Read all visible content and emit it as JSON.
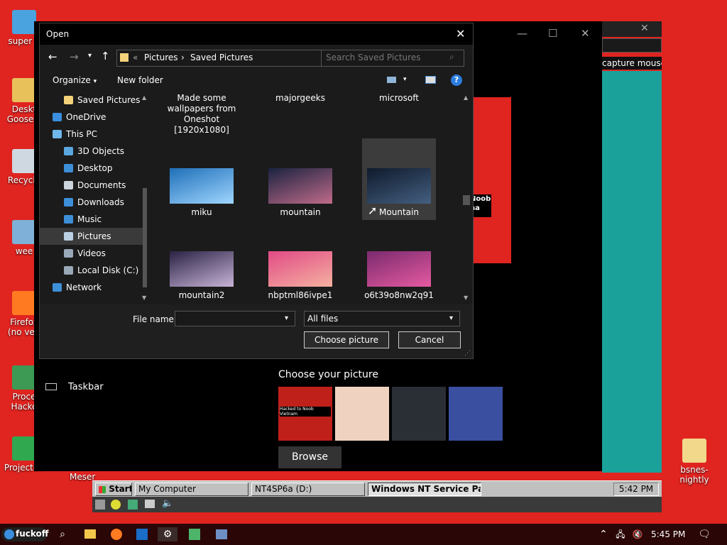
{
  "desktop": {
    "icons_left": [
      {
        "label": "super p",
        "color": "#4aa3df"
      },
      {
        "label": "Deskt\nGoose v",
        "color": "#e8c15b"
      },
      {
        "label": "Recycle",
        "color": "#cfd8e0"
      },
      {
        "label": "wee",
        "color": "#7fb0d8"
      },
      {
        "label": "Firefox\n(no veri",
        "color": "#ff7a20"
      },
      {
        "label": "Proce\nHacke",
        "color": "#3c9a54"
      },
      {
        "label": "Project64",
        "color": "#2fa84f"
      }
    ],
    "meser_label": "Meser",
    "right_icon": {
      "label": "bsnes-nightly",
      "color": "#f1d88a"
    }
  },
  "settings_bg": {
    "taskbar_label": "Taskbar",
    "choose_picture_heading": "Choose your picture",
    "browse_label": "Browse",
    "capture_mouse": "capture mouse",
    "thumbs": [
      {
        "name": "hacked-image",
        "color": "#c0201a",
        "text": "Hacked to Noob Vietnam"
      },
      {
        "name": "claymation-figure",
        "color": "#f0d2c0"
      },
      {
        "name": "text-screenshot",
        "color": "#2a2f36"
      },
      {
        "name": "collage",
        "color": "#3a4fa0"
      },
      {
        "name": "white-character",
        "color": "#000000"
      }
    ],
    "noob_label": "Noob\nha"
  },
  "dialog": {
    "title": "Open",
    "breadcrumb": {
      "prefix": "«",
      "part1": "Pictures",
      "sep": "›",
      "part2": "Saved Pictures"
    },
    "search_placeholder": "Search Saved Pictures",
    "toolbar": {
      "organize": "Organize",
      "new_folder": "New folder"
    },
    "nav": [
      {
        "label": "Saved Pictures",
        "icon": "folder-icon",
        "color": "#f3d27a"
      },
      {
        "label": "OneDrive",
        "icon": "cloud-icon",
        "color": "#3a8fde"
      },
      {
        "label": "This PC",
        "icon": "computer-icon",
        "color": "#6fb8ec"
      },
      {
        "label": "3D Objects",
        "icon": "cube-icon",
        "color": "#5aa7e0"
      },
      {
        "label": "Desktop",
        "icon": "desktop-icon",
        "color": "#3d8fd8"
      },
      {
        "label": "Documents",
        "icon": "document-icon",
        "color": "#ccd4dc"
      },
      {
        "label": "Downloads",
        "icon": "download-icon",
        "color": "#3d8fd8"
      },
      {
        "label": "Music",
        "icon": "music-icon",
        "color": "#3d8fd8"
      },
      {
        "label": "Pictures",
        "icon": "pictures-icon",
        "color": "#bcd0e4"
      },
      {
        "label": "Videos",
        "icon": "video-icon",
        "color": "#9aa9b8"
      },
      {
        "label": "Local Disk (C:)",
        "icon": "disk-icon",
        "color": "#9aa9b8"
      },
      {
        "label": "Network",
        "icon": "network-icon",
        "color": "#3d8fd8"
      }
    ],
    "top_row": [
      "Made some wallpapers from Oneshot [1920x1080]",
      "majorgeeks",
      "microsoft"
    ],
    "files": [
      {
        "label": "miku",
        "c1": "#1f6fb8",
        "c2": "#9fd6ff"
      },
      {
        "label": "mountain",
        "c1": "#1a2340",
        "c2": "#c06b8a"
      },
      {
        "label": "Mountain",
        "c1": "#0f1a2c",
        "c2": "#445f80"
      },
      {
        "label": "mountain2",
        "c1": "#2a2244",
        "c2": "#c8b4d8"
      },
      {
        "label": "nbptml86ivpe1",
        "c1": "#e24a86",
        "c2": "#f4b1a0"
      },
      {
        "label": "o6t39o8nw2q91",
        "c1": "#7a2a6e",
        "c2": "#e65aa0"
      }
    ],
    "file_name_label": "File name:",
    "file_name_value": "",
    "filter_value": "All files",
    "choose_button": "Choose picture",
    "cancel_button": "Cancel"
  },
  "win98": {
    "start": "Start",
    "tasks": [
      "My Computer",
      "NT4SP6a (D:)",
      "Windows NT Service Pa..."
    ],
    "clock": "5:42 PM"
  },
  "taskbar": {
    "start_label": "fuckoff",
    "clock": "5:45 PM"
  }
}
